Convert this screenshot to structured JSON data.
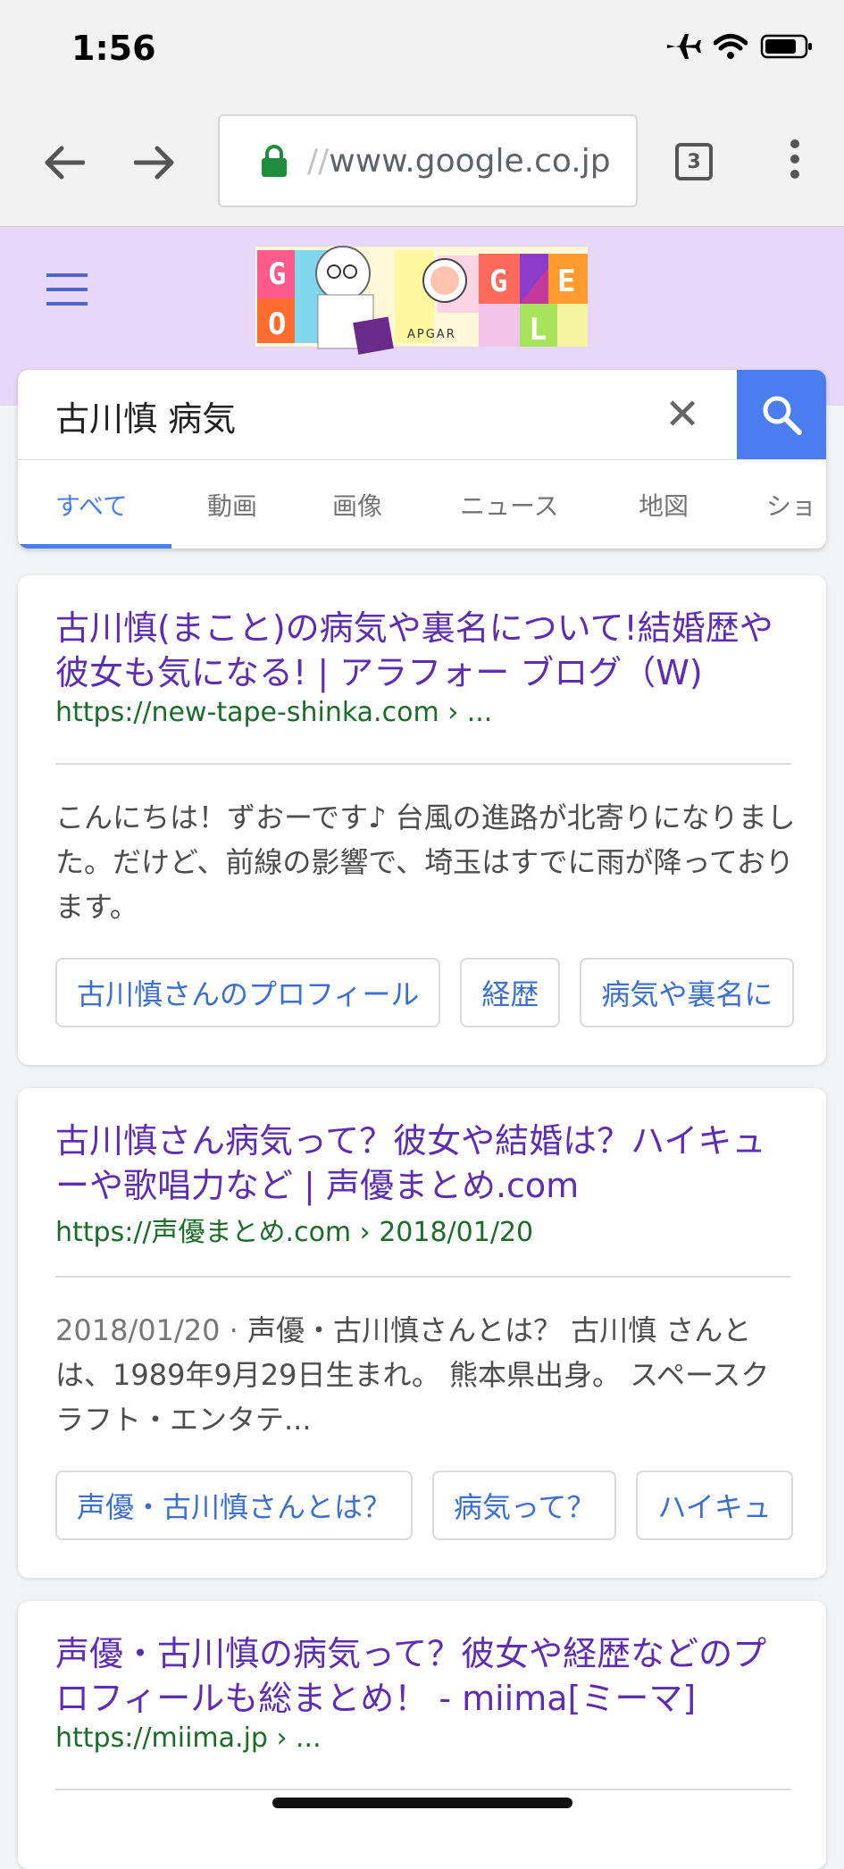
{
  "status": {
    "time": "1:56"
  },
  "browser": {
    "url_prefix": "//",
    "url_main": "www.google.co.jp",
    "tab_count": "3"
  },
  "doodle": {
    "caption": "APGAR",
    "letters": [
      "G",
      "O",
      "G",
      "E",
      "L"
    ]
  },
  "search": {
    "query": "古川慎 病気",
    "clear_label": "✕",
    "tabs": [
      "すべて",
      "動画",
      "画像",
      "ニュース",
      "地図",
      "ショ"
    ]
  },
  "results": [
    {
      "title": "古川慎(まこと)の病気や裏名について!結婚歴や彼女も気になる! | アラフォー ブログ（W)",
      "url": "https://new-tape-shinka.com › ...",
      "date": "",
      "snippet": "こんにちは！ずおーです♪ 台風の進路が北寄りになりました。だけど、前線の影響で、埼玉はすでに雨が降っております。",
      "chips": [
        "古川慎さんのプロフィール",
        "経歴",
        "病気や裏名に"
      ]
    },
    {
      "title": "古川慎さん病気って？彼女や結婚は？ハイキューや歌唱力など | 声優まとめ.com",
      "url": "https://声優まとめ.com › 2018/01/20",
      "date": "2018/01/20 · ",
      "snippet": "声優・古川慎さんとは？ 古川慎 さんとは、1989年9月29日生まれ。 熊本県出身。 スペースクラフト・エンタテ...",
      "chips": [
        "声優・古川慎さんとは？",
        "病気って？",
        "ハイキュ"
      ]
    },
    {
      "title": "声優・古川慎の病気って？彼女や経歴などのプロフィールも総まとめ！ - miima[ミーマ]",
      "url": "https://miima.jp › ..."
    }
  ],
  "colors": {
    "accent": "#4a7ef0",
    "title_link": "#5d2db2",
    "url_green": "#1d6b2b",
    "header_bg": "#e7d7f9"
  }
}
